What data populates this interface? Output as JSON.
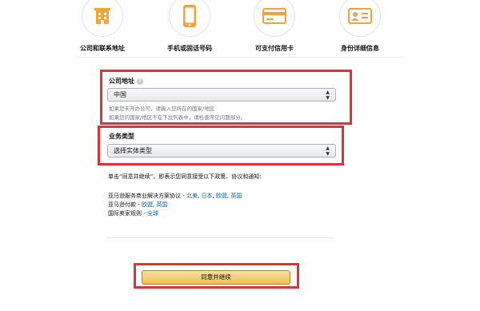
{
  "steps": [
    {
      "label": "公司和联系地址",
      "icon": "building-icon"
    },
    {
      "label": "手机或固话号码",
      "icon": "mobile-phone-icon"
    },
    {
      "label": "可支付信用卡",
      "icon": "credit-card-icon"
    },
    {
      "label": "身份详细信息",
      "icon": "id-card-icon"
    }
  ],
  "company_address": {
    "label": "公司地址",
    "help": "?",
    "value": "中国",
    "hint1": "如果您未开办公司，请输入您所在的国家/地区",
    "hint2": "如果您的国家/地区不在下拉列表中，请检查常见问题部分。"
  },
  "business_type": {
    "label": "业务类型",
    "value": "选择实体类型"
  },
  "agreement": {
    "intro": "单击“同意并继续”，即表示您同意接受以下政策、协议和通知:",
    "line1_prefix": "亚马逊服务商业解决方案协议 - ",
    "line1_links": [
      "北美",
      "日本",
      "欧盟",
      "英国"
    ],
    "line2_prefix": "亚马逊付款 - ",
    "line2_links": [
      "欧盟",
      "英国"
    ],
    "line3_prefix": "国际卖家规则 - ",
    "line3_links": [
      "全球"
    ]
  },
  "submit_label": "同意并继续",
  "colors": {
    "highlight": "#e0313b",
    "icon_orange": "#f3a33a",
    "link": "#0066c0",
    "button": "#f0c14b"
  }
}
